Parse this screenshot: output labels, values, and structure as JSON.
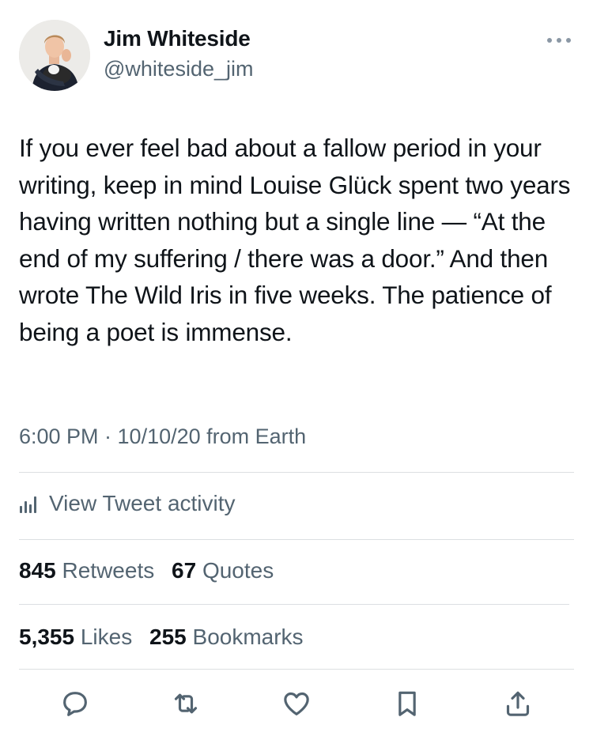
{
  "author": {
    "name": "Jim Whiteside",
    "handle": "@whiteside_jim"
  },
  "tweet": {
    "text": "If you ever feel bad about a fallow period in your writing, keep in mind Louise Glück spent two years having written nothing but a single line — “At the end of my suffering / there was a door.” And then wrote The Wild Iris in five weeks. The patience of being a poet is immense.",
    "timestamp": "6:00 PM · 10/10/20 from Earth"
  },
  "activity": {
    "label": "View Tweet activity",
    "icon": "bar-chart-icon"
  },
  "stats": {
    "retweets": {
      "count": "845",
      "label": "Retweets"
    },
    "quotes": {
      "count": "67",
      "label": "Quotes"
    },
    "likes": {
      "count": "5,355",
      "label": "Likes"
    },
    "bookmarks": {
      "count": "255",
      "label": "Bookmarks"
    }
  },
  "actions": [
    "reply-icon",
    "retweet-icon",
    "like-icon",
    "bookmark-icon",
    "share-icon"
  ],
  "colors": {
    "text": "#0f1419",
    "secondary": "#536471",
    "divider": "#dcdfe2"
  }
}
